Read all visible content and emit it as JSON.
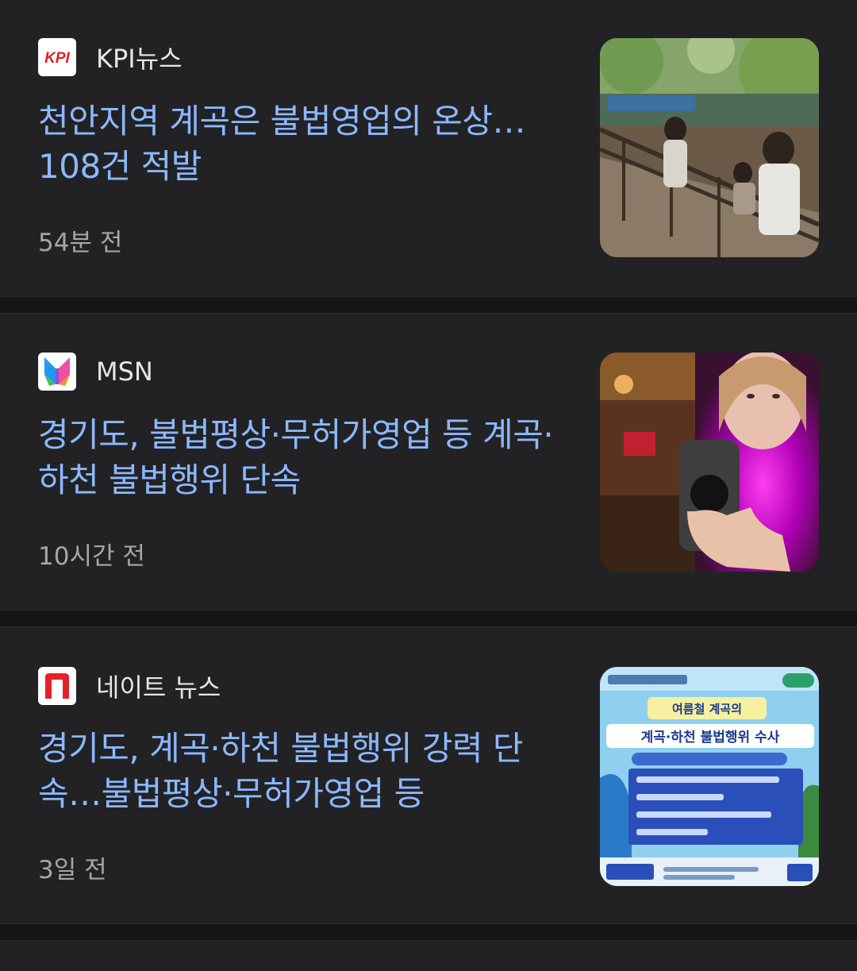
{
  "articles": [
    {
      "source": "KPI뉴스",
      "logo_icon": "kpi-logo-icon",
      "headline": "천안지역 계곡은 불법영업의 온상…108건 적발",
      "time": "54분 전",
      "thumbnail_icon": "valley-restaurant-photo"
    },
    {
      "source": "MSN",
      "logo_icon": "msn-butterfly-logo-icon",
      "headline": "경기도, 불법평상·무허가영업 등 계곡·하천 불법행위 단속",
      "time": "10시간 전",
      "thumbnail_icon": "hand-holding-device-photo"
    },
    {
      "source": "네이트 뉴스",
      "logo_icon": "nate-n-logo-icon",
      "headline": "경기도, 계곡·하천 불법행위 강력 단속…불법평상·무허가영업 등",
      "time": "3일 전",
      "thumbnail_icon": "enforcement-poster-image",
      "thumbnail": {
        "line1": "여름철 계곡의",
        "line2": "계곡·하천 불법행위 수사"
      }
    }
  ],
  "colors": {
    "background": "#1b1b1d",
    "card": "#222224",
    "headline": "#8cb8ff",
    "source": "#e6e6e8",
    "time": "#a6a6aa",
    "kpi_red": "#e02020",
    "nate_red": "#e4222b"
  }
}
